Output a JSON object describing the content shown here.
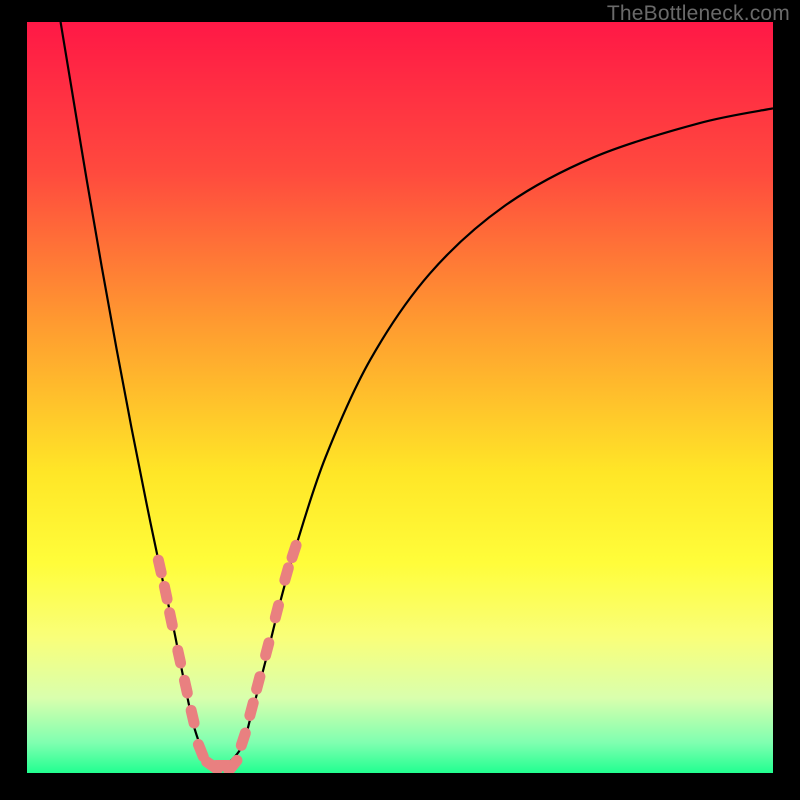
{
  "watermark": "TheBottleneck.com",
  "chart_data": {
    "type": "line",
    "title": "",
    "xlabel": "",
    "ylabel": "",
    "xlim": [
      0,
      100
    ],
    "ylim": [
      0,
      100
    ],
    "grid": false,
    "background_gradient": {
      "direction": "vertical",
      "stops": [
        {
          "offset": 0.0,
          "color": "#ff1846"
        },
        {
          "offset": 0.2,
          "color": "#ff4a3e"
        },
        {
          "offset": 0.4,
          "color": "#ff9a30"
        },
        {
          "offset": 0.6,
          "color": "#ffe627"
        },
        {
          "offset": 0.72,
          "color": "#fffd3a"
        },
        {
          "offset": 0.82,
          "color": "#f9ff7a"
        },
        {
          "offset": 0.9,
          "color": "#d9ffad"
        },
        {
          "offset": 0.96,
          "color": "#7fffb0"
        },
        {
          "offset": 1.0,
          "color": "#21ff90"
        }
      ]
    },
    "series": [
      {
        "name": "bottleneck-curve",
        "color": "#000000",
        "x": [
          4.5,
          6,
          8,
          10,
          12,
          14,
          16,
          18,
          19.5,
          20.9,
          22.3,
          23.5,
          24.5,
          26.5,
          28.8,
          30,
          32,
          34,
          36,
          40,
          46,
          54,
          64,
          76,
          90,
          100
        ],
        "values": [
          100,
          91,
          79,
          67.5,
          56.5,
          46,
          36,
          26.5,
          20,
          13,
          6.5,
          3,
          1,
          1,
          3.5,
          7.5,
          15,
          23,
          30,
          42,
          55,
          66.5,
          75.5,
          82,
          86.5,
          88.5
        ]
      }
    ],
    "markers": [
      {
        "name": "data-points",
        "shape": "rounded-capsule",
        "color": "#e98080",
        "points": [
          {
            "x": 17.8,
            "y": 27.5
          },
          {
            "x": 18.6,
            "y": 24.0
          },
          {
            "x": 19.3,
            "y": 20.5
          },
          {
            "x": 20.4,
            "y": 15.5
          },
          {
            "x": 21.3,
            "y": 11.5
          },
          {
            "x": 22.2,
            "y": 7.5
          },
          {
            "x": 23.3,
            "y": 3.0
          },
          {
            "x": 24.8,
            "y": 1.0
          },
          {
            "x": 26.2,
            "y": 1.0
          },
          {
            "x": 27.6,
            "y": 1.0
          },
          {
            "x": 29.0,
            "y": 4.5
          },
          {
            "x": 30.1,
            "y": 8.5
          },
          {
            "x": 31.0,
            "y": 12.0
          },
          {
            "x": 32.2,
            "y": 16.5
          },
          {
            "x": 33.5,
            "y": 21.5
          },
          {
            "x": 34.8,
            "y": 26.5
          },
          {
            "x": 35.8,
            "y": 29.5
          }
        ]
      }
    ]
  }
}
